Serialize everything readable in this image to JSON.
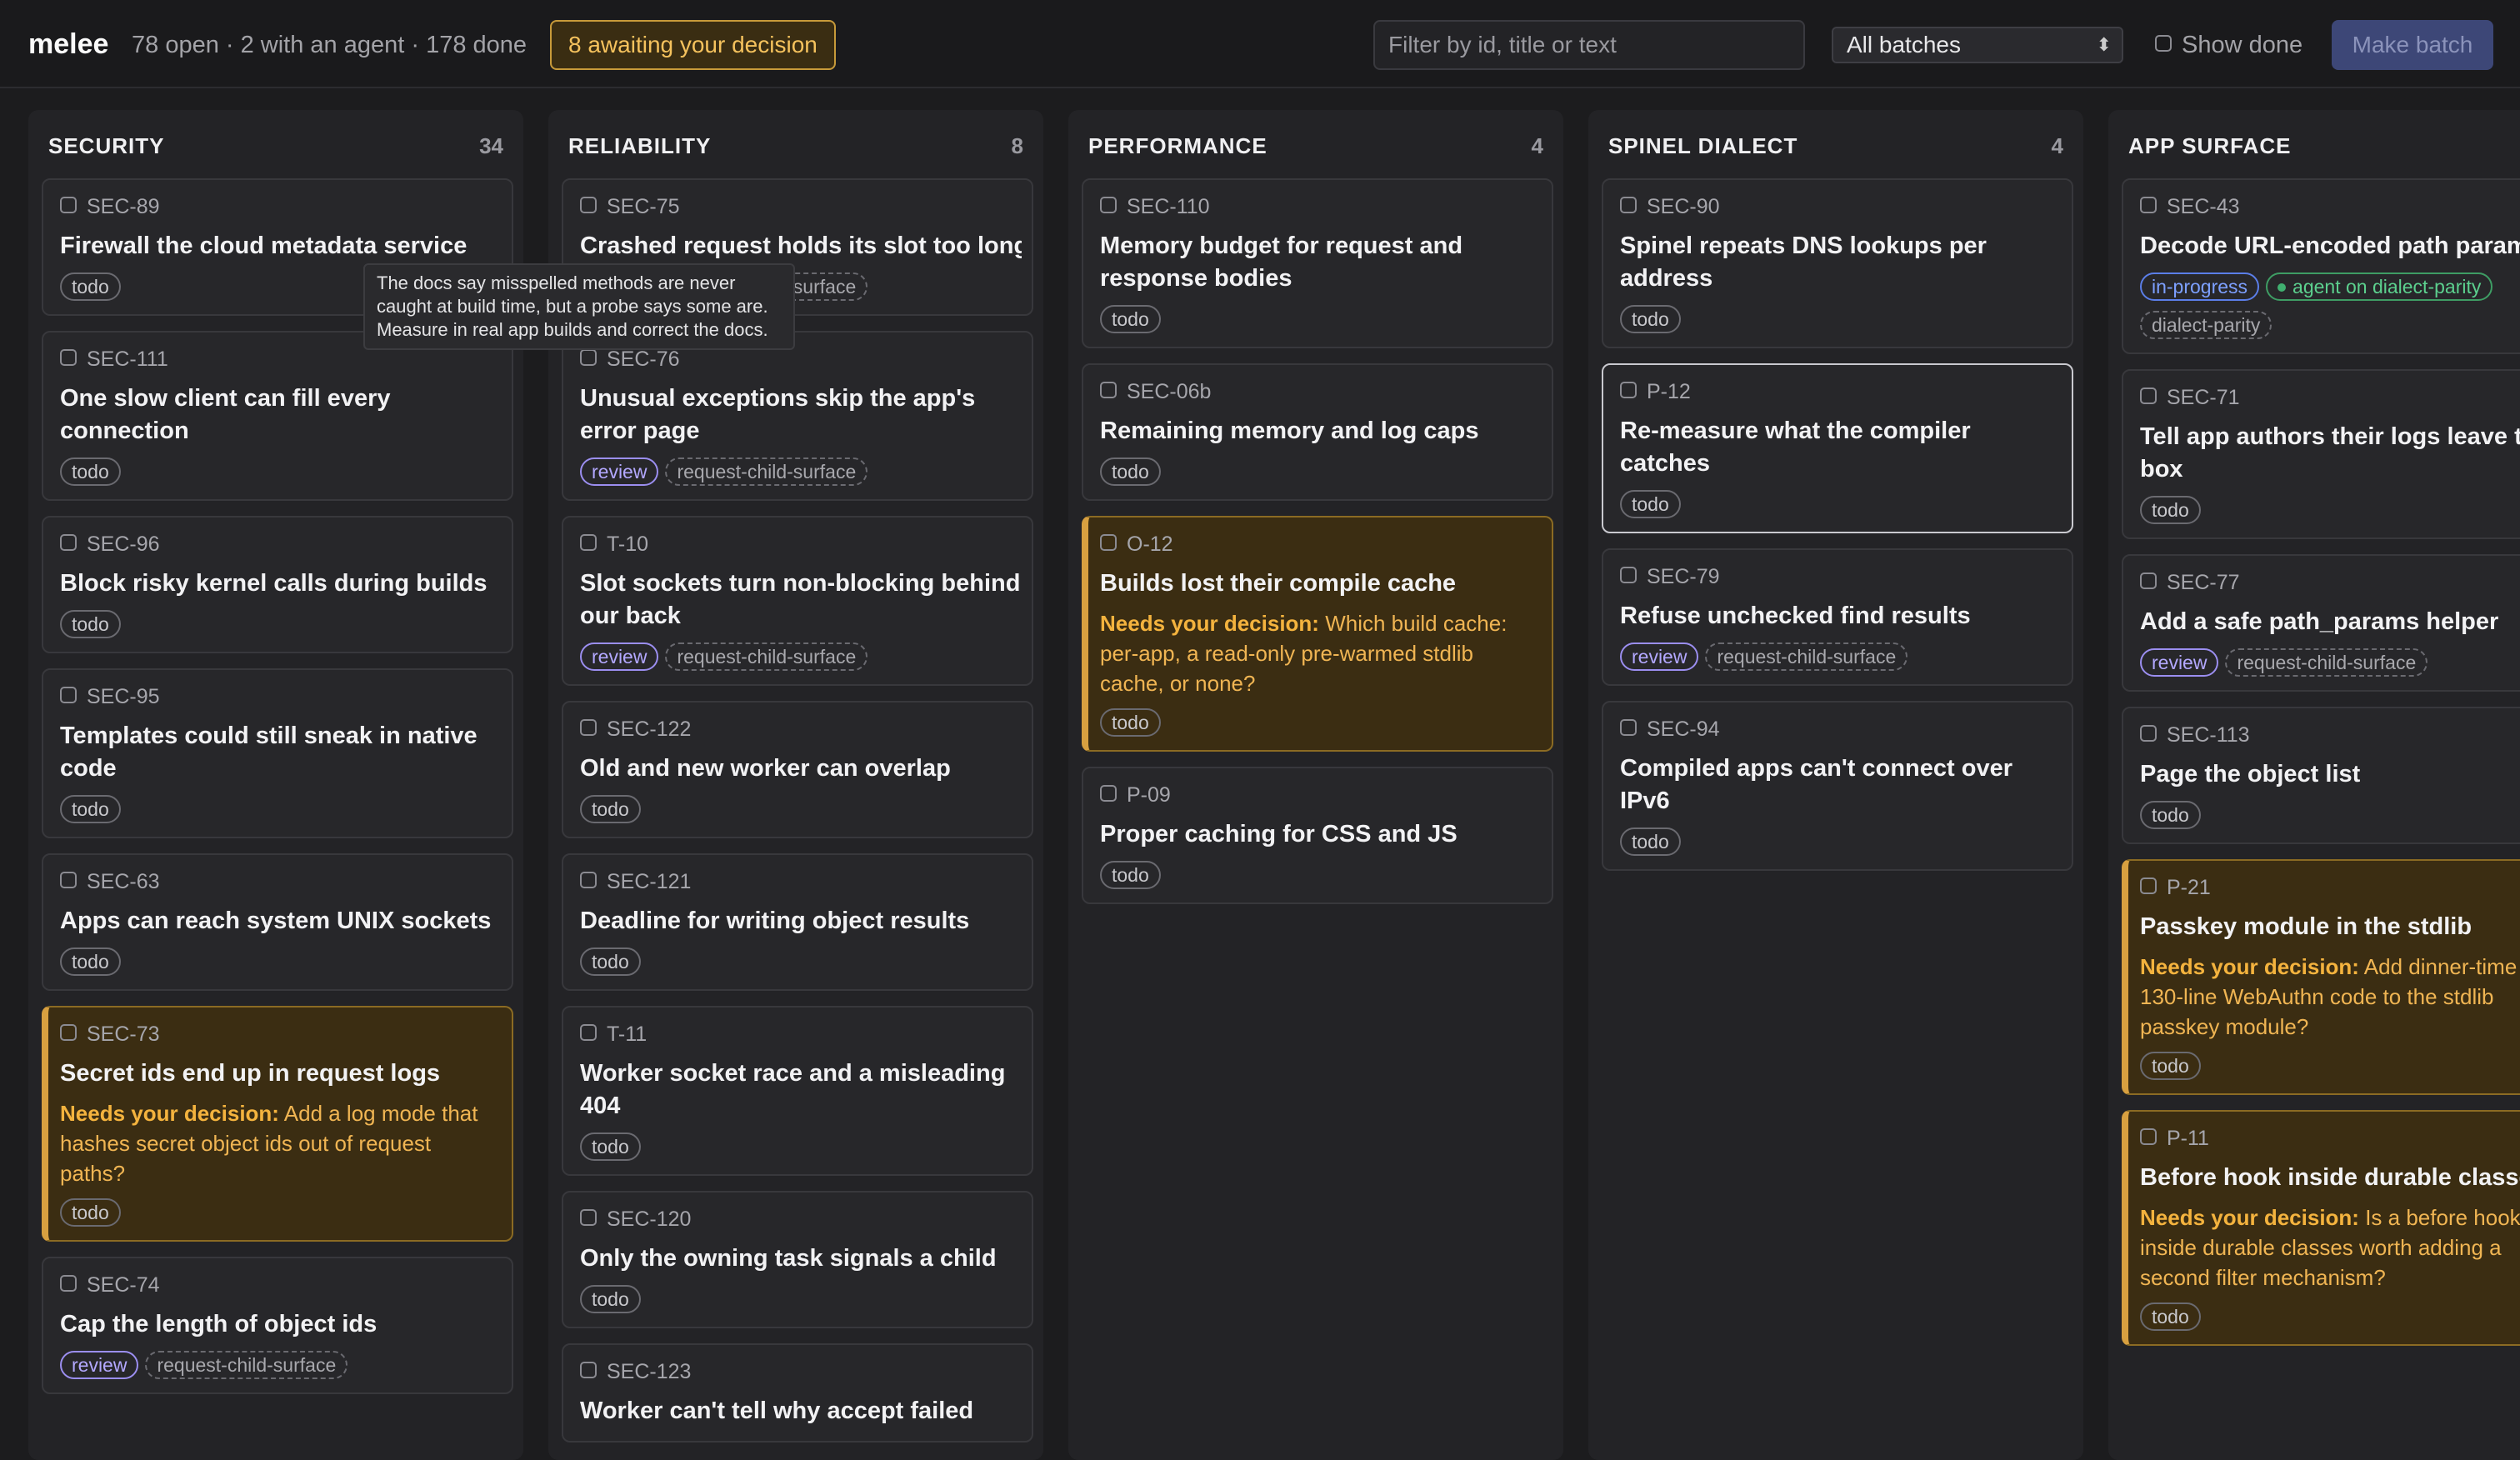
{
  "header": {
    "app_name": "melee",
    "summary": "78 open · 2 with an agent · 178 done",
    "awaiting_label": "8 awaiting your decision",
    "filter_placeholder": "Filter by id, title or text",
    "batch_selected": "All batches",
    "show_done_label": "Show done",
    "make_batch_label": "Make batch"
  },
  "colors": {
    "accent_warning": "#d8a040",
    "review": "#9b8ef0",
    "agent": "#3e9d64",
    "progress": "#5b7ee8"
  },
  "decision_prefix": "Needs your decision:",
  "tooltip": [
    "The docs say misspelled methods are never",
    "caught at build time, but a probe says some are.",
    "Measure in real app builds and correct the docs."
  ],
  "columns": [
    {
      "name": "SECURITY",
      "count": "34",
      "cards": [
        {
          "id": "SEC-89",
          "title": [
            "Firewall the cloud metadata service"
          ],
          "badges": [
            {
              "t": "todo",
              "k": "todo"
            }
          ]
        },
        {
          "id": "SEC-111",
          "title": [
            "One slow client can fill every",
            "connection"
          ],
          "badges": [
            {
              "t": "todo",
              "k": "todo"
            }
          ]
        },
        {
          "id": "SEC-96",
          "title": [
            "Block risky kernel calls during builds"
          ],
          "badges": [
            {
              "t": "todo",
              "k": "todo"
            }
          ]
        },
        {
          "id": "SEC-95",
          "title": [
            "Templates could still sneak in native",
            "code"
          ],
          "badges": [
            {
              "t": "todo",
              "k": "todo"
            }
          ]
        },
        {
          "id": "SEC-63",
          "title": [
            "Apps can reach system UNIX sockets"
          ],
          "badges": [
            {
              "t": "todo",
              "k": "todo"
            }
          ]
        },
        {
          "id": "SEC-73",
          "title": [
            "Secret ids end up in request logs"
          ],
          "decision": [
            "Add a log mode that",
            "hashes secret object ids out of request",
            "paths?"
          ],
          "badges": [
            {
              "t": "todo",
              "k": "todo"
            }
          ]
        },
        {
          "id": "SEC-74",
          "title": [
            "Cap the length of object ids"
          ],
          "badges": [
            {
              "t": "review",
              "k": "review"
            },
            {
              "t": "request-child-surface",
              "k": "dashed"
            }
          ]
        }
      ]
    },
    {
      "name": "RELIABILITY",
      "count": "8",
      "cards": [
        {
          "id": "SEC-75",
          "title": [
            "Crashed request holds its slot too long"
          ],
          "badges": [
            {
              "t": "review",
              "k": "review"
            },
            {
              "t": "request-child-surface",
              "k": "dashed"
            }
          ]
        },
        {
          "id": "SEC-76",
          "title": [
            "Unusual exceptions skip the app's",
            "error page"
          ],
          "badges": [
            {
              "t": "review",
              "k": "review"
            },
            {
              "t": "request-child-surface",
              "k": "dashed"
            }
          ]
        },
        {
          "id": "T-10",
          "title": [
            "Slot sockets turn non-blocking behind",
            "our back"
          ],
          "badges": [
            {
              "t": "review",
              "k": "review"
            },
            {
              "t": "request-child-surface",
              "k": "dashed"
            }
          ]
        },
        {
          "id": "SEC-122",
          "title": [
            "Old and new worker can overlap"
          ],
          "badges": [
            {
              "t": "todo",
              "k": "todo"
            }
          ]
        },
        {
          "id": "SEC-121",
          "title": [
            "Deadline for writing object results"
          ],
          "badges": [
            {
              "t": "todo",
              "k": "todo"
            }
          ]
        },
        {
          "id": "T-11",
          "title": [
            "Worker socket race and a misleading",
            "404"
          ],
          "badges": [
            {
              "t": "todo",
              "k": "todo"
            }
          ]
        },
        {
          "id": "SEC-120",
          "title": [
            "Only the owning task signals a child"
          ],
          "badges": [
            {
              "t": "todo",
              "k": "todo"
            }
          ]
        },
        {
          "id": "SEC-123",
          "title": [
            "Worker can't tell why accept failed"
          ],
          "badges": []
        }
      ]
    },
    {
      "name": "PERFORMANCE",
      "count": "4",
      "cards": [
        {
          "id": "SEC-110",
          "title": [
            "Memory budget for request and",
            "response bodies"
          ],
          "badges": [
            {
              "t": "todo",
              "k": "todo"
            }
          ]
        },
        {
          "id": "SEC-06b",
          "title": [
            "Remaining memory and log caps"
          ],
          "badges": [
            {
              "t": "todo",
              "k": "todo"
            }
          ]
        },
        {
          "id": "O-12",
          "title": [
            "Builds lost their compile cache"
          ],
          "decision": [
            "Which build cache:",
            "per-app, a read-only pre-warmed stdlib",
            "cache, or none?"
          ],
          "badges": [
            {
              "t": "todo",
              "k": "todo"
            }
          ]
        },
        {
          "id": "P-09",
          "title": [
            "Proper caching for CSS and JS"
          ],
          "badges": [
            {
              "t": "todo",
              "k": "todo"
            }
          ]
        }
      ]
    },
    {
      "name": "SPINEL DIALECT",
      "count": "4",
      "cards": [
        {
          "id": "SEC-90",
          "title": [
            "Spinel repeats DNS lookups per",
            "address"
          ],
          "badges": [
            {
              "t": "todo",
              "k": "todo"
            }
          ]
        },
        {
          "id": "P-12",
          "title": [
            "Re-measure what the compiler",
            "catches"
          ],
          "selected": true,
          "badges": [
            {
              "t": "todo",
              "k": "todo"
            }
          ]
        },
        {
          "id": "SEC-79",
          "title": [
            "Refuse unchecked find results"
          ],
          "badges": [
            {
              "t": "review",
              "k": "review"
            },
            {
              "t": "request-child-surface",
              "k": "dashed"
            }
          ]
        },
        {
          "id": "SEC-94",
          "title": [
            "Compiled apps can't connect over",
            "IPv6"
          ],
          "badges": [
            {
              "t": "todo",
              "k": "todo"
            }
          ]
        }
      ]
    },
    {
      "name": "APP SURFACE",
      "count": "",
      "cards": [
        {
          "id": "SEC-43",
          "title": [
            "Decode URL-encoded path params"
          ],
          "badges": [
            {
              "t": "in-progress",
              "k": "progress"
            },
            {
              "t": "agent on dialect-parity",
              "k": "agent"
            }
          ],
          "badges2": [
            {
              "t": "dialect-parity",
              "k": "dashed"
            }
          ]
        },
        {
          "id": "SEC-71",
          "title": [
            "Tell app authors their logs leave the",
            "box"
          ],
          "badges": [
            {
              "t": "todo",
              "k": "todo"
            }
          ]
        },
        {
          "id": "SEC-77",
          "title": [
            "Add a safe path_params helper"
          ],
          "badges": [
            {
              "t": "review",
              "k": "review"
            },
            {
              "t": "request-child-surface",
              "k": "dashed"
            }
          ]
        },
        {
          "id": "SEC-113",
          "title": [
            "Page the object list"
          ],
          "badges": [
            {
              "t": "todo",
              "k": "todo"
            }
          ]
        },
        {
          "id": "P-21",
          "title": [
            "Passkey module in the stdlib"
          ],
          "decision": [
            "Add dinner-time",
            "130-line WebAuthn code to the stdlib",
            "passkey module?"
          ],
          "badges": [
            {
              "t": "todo",
              "k": "todo"
            }
          ]
        },
        {
          "id": "P-11",
          "title": [
            "Before hook inside durable classes"
          ],
          "decision": [
            "Is a before hook",
            "inside durable classes worth adding a",
            "second filter mechanism?"
          ],
          "badges": [
            {
              "t": "todo",
              "k": "todo"
            }
          ]
        }
      ]
    }
  ]
}
